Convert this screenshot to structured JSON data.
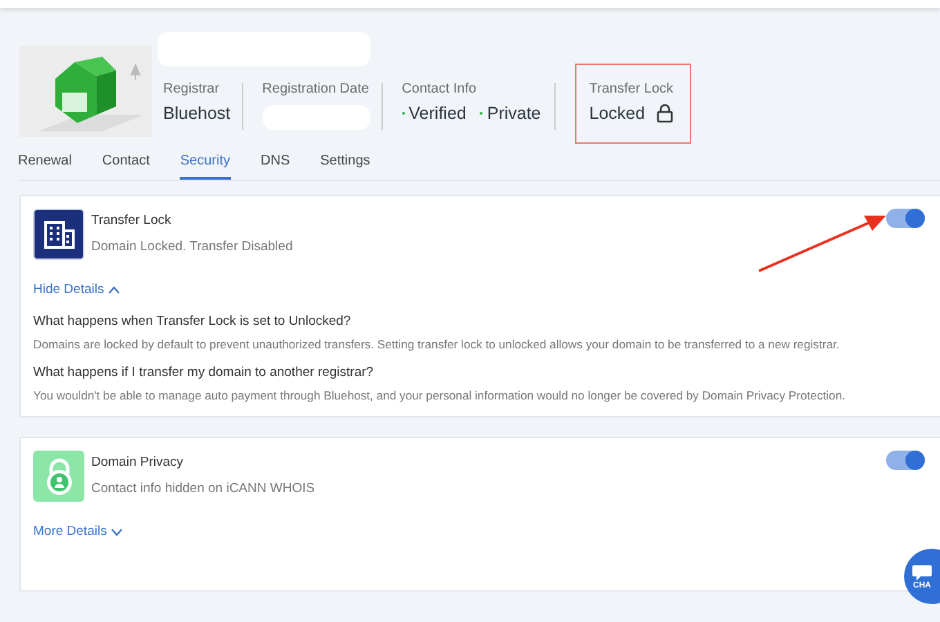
{
  "header": {
    "stats": [
      {
        "kind": "text",
        "label": "Registrar",
        "value": "Bluehost",
        "highlighted": false
      },
      {
        "kind": "redacted",
        "label": "Registration Date",
        "highlighted": false
      },
      {
        "kind": "bullets",
        "label": "Contact Info",
        "values": [
          "Verified",
          "Private"
        ],
        "highlighted": false
      },
      {
        "kind": "lock",
        "label": "Transfer Lock",
        "value": "Locked",
        "highlighted": true
      }
    ]
  },
  "tabs": [
    {
      "label": "Renewal",
      "selected": false
    },
    {
      "label": "Contact",
      "selected": false
    },
    {
      "label": "Security",
      "selected": true
    },
    {
      "label": "DNS",
      "selected": false
    },
    {
      "label": "Settings",
      "selected": false
    }
  ],
  "cards": [
    {
      "kind": "lock_setting",
      "title": "Transfer Lock",
      "subtitle": "Domain Locked. Transfer Disabled",
      "on": true,
      "annotated": true,
      "details": {
        "label": "Hide Details",
        "expanded": true
      },
      "faqs": [
        {
          "question": "What happens when Transfer Lock is set to Unlocked?",
          "answer": "Domains are locked by default to prevent unauthorized transfers. Setting transfer lock to unlocked allows your domain to be transferred to a new registrar."
        },
        {
          "question": "What happens if I transfer my domain to another registrar?",
          "answer": "You wouldn't be able to manage auto payment through Bluehost, and your personal information would no longer be covered by Domain Privacy Protection."
        }
      ]
    },
    {
      "kind": "privacy_setting",
      "title": "Domain Privacy",
      "subtitle": "Contact info hidden on iCANN WHOIS",
      "on": true,
      "annotated": false,
      "details": {
        "label": "More Details",
        "expanded": false
      }
    }
  ],
  "chat_button": {
    "label": "CHA"
  }
}
